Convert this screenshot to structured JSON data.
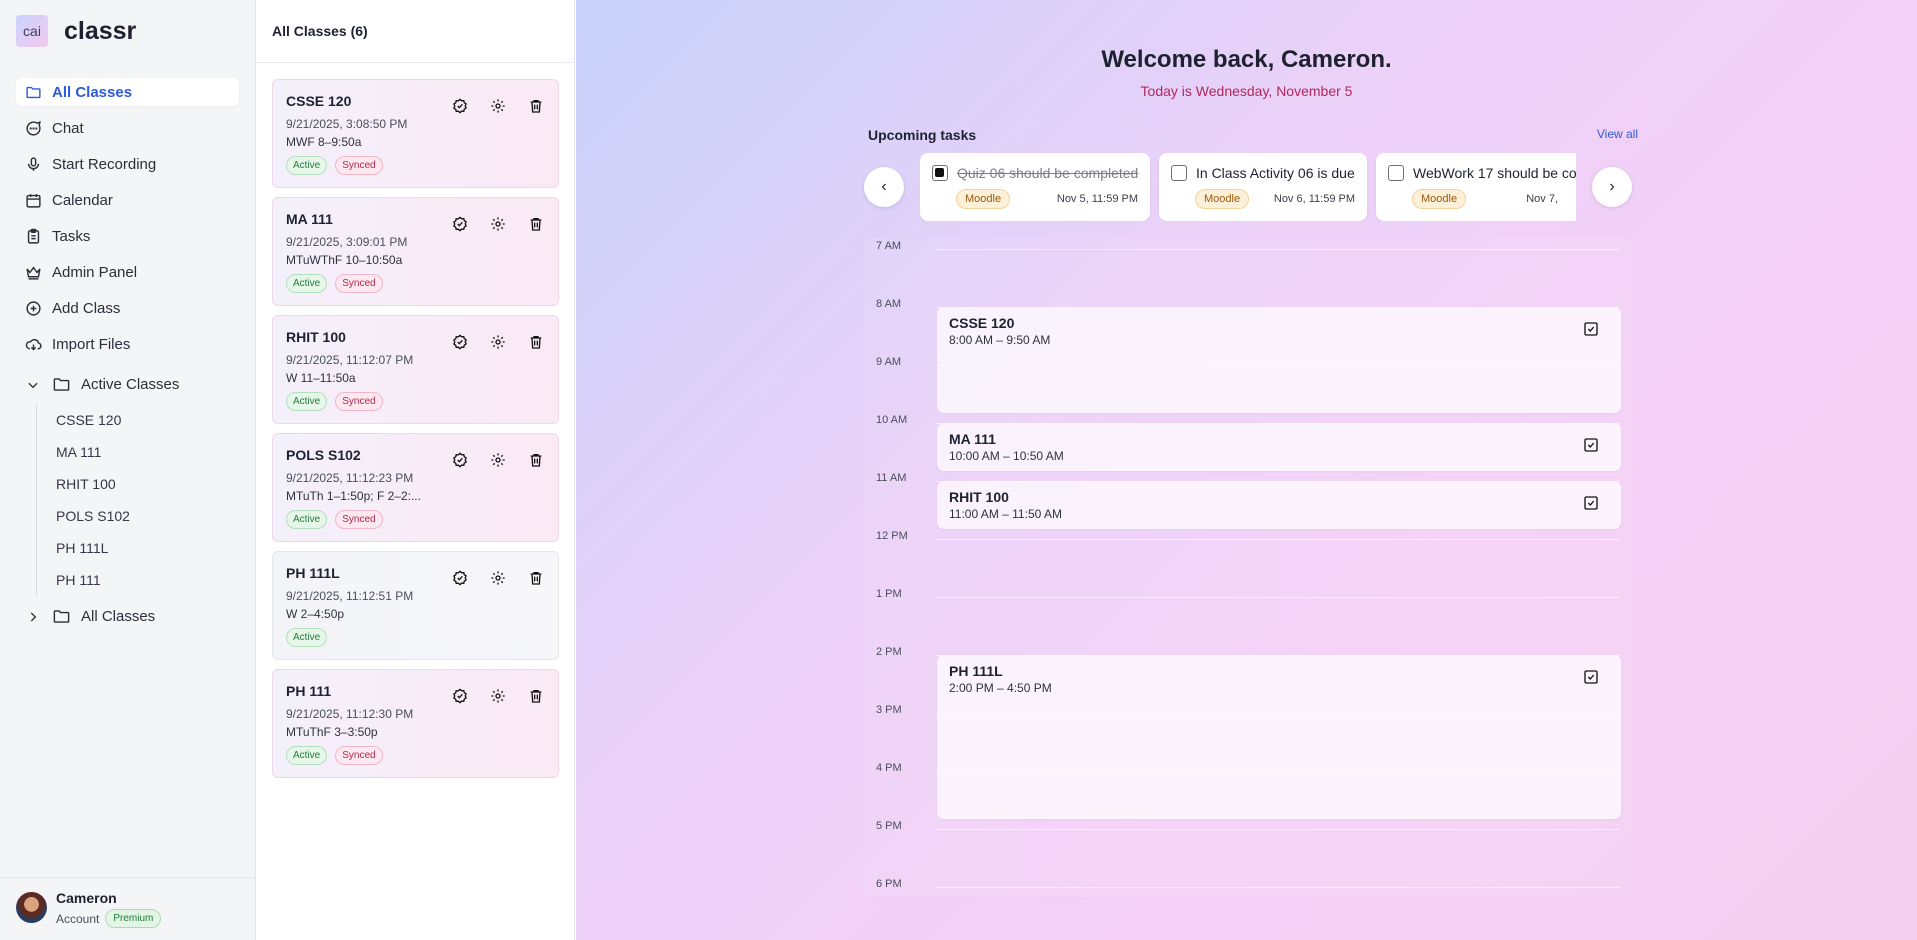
{
  "app": {
    "logo_text": "cai",
    "name": "classr"
  },
  "sidebar": {
    "nav": [
      {
        "label": "All Classes",
        "icon": "folder-icon"
      },
      {
        "label": "Chat",
        "icon": "chat-icon"
      },
      {
        "label": "Start Recording",
        "icon": "microphone-icon"
      },
      {
        "label": "Calendar",
        "icon": "calendar-icon"
      },
      {
        "label": "Tasks",
        "icon": "clipboard-icon"
      },
      {
        "label": "Admin Panel",
        "icon": "crown-icon"
      },
      {
        "label": "Add Class",
        "icon": "plus-circle-icon"
      },
      {
        "label": "Import Files",
        "icon": "cloud-download-icon"
      }
    ],
    "active_group": {
      "label": "Active Classes",
      "items": [
        "CSSE 120",
        "MA 111",
        "RHIT 100",
        "POLS S102",
        "PH 111L",
        "PH 111"
      ]
    },
    "all_group": {
      "label": "All Classes"
    },
    "user": {
      "name": "Cameron",
      "account": "Account",
      "plan": "Premium"
    }
  },
  "classes": {
    "header": "All Classes (6)",
    "items": [
      {
        "code": "CSSE 120",
        "created": "9/21/2025, 3:08:50 PM",
        "schedule": "MWF 8–9:50a",
        "status": "Active",
        "sync": "Synced"
      },
      {
        "code": "MA 111",
        "created": "9/21/2025, 3:09:01 PM",
        "schedule": "MTuWThF 10–10:50a",
        "status": "Active",
        "sync": "Synced"
      },
      {
        "code": "RHIT 100",
        "created": "9/21/2025, 11:12:07 PM",
        "schedule": "W 11–11:50a",
        "status": "Active",
        "sync": "Synced"
      },
      {
        "code": "POLS S102",
        "created": "9/21/2025, 11:12:23 PM",
        "schedule": "MTuTh 1–1:50p; F 2–2:...",
        "status": "Active",
        "sync": "Synced"
      },
      {
        "code": "PH 111L",
        "created": "9/21/2025, 11:12:51 PM",
        "schedule": "W 2–4:50p",
        "status": "Active",
        "sync": ""
      },
      {
        "code": "PH 111",
        "created": "9/21/2025, 11:12:30 PM",
        "schedule": "MTuThF 3–3:50p",
        "status": "Active",
        "sync": "Synced"
      }
    ]
  },
  "main": {
    "welcome": "Welcome back, Cameron.",
    "today": "Today is Wednesday, November 5",
    "upcoming_title": "Upcoming tasks",
    "view_all": "View all",
    "prev": "‹",
    "next": "›",
    "tasks": [
      {
        "label": "Quiz 06 should be completed",
        "source": "Moodle",
        "due": "Nov 5, 11:59 PM",
        "done": true
      },
      {
        "label": "In Class Activity 06 is due",
        "source": "Moodle",
        "due": "Nov 6, 11:59 PM",
        "done": false
      },
      {
        "label": "WebWork 17 should be co",
        "source": "Moodle",
        "due": "Nov 7,",
        "done": false
      }
    ],
    "calendar": {
      "hours": [
        "7 AM",
        "8 AM",
        "9 AM",
        "10 AM",
        "11 AM",
        "12 PM",
        "1 PM",
        "2 PM",
        "3 PM",
        "4 PM",
        "5 PM",
        "6 PM"
      ],
      "events": [
        {
          "title": "CSSE 120",
          "time": "8:00 AM – 9:50 AM",
          "start": 8.0,
          "end": 9.833
        },
        {
          "title": "MA 111",
          "time": "10:00 AM – 10:50 AM",
          "start": 10.0,
          "end": 10.833
        },
        {
          "title": "RHIT 100",
          "time": "11:00 AM – 11:50 AM",
          "start": 11.0,
          "end": 11.833
        },
        {
          "title": "PH 111L",
          "time": "2:00 PM – 4:50 PM",
          "start": 14.0,
          "end": 16.833
        }
      ]
    }
  }
}
